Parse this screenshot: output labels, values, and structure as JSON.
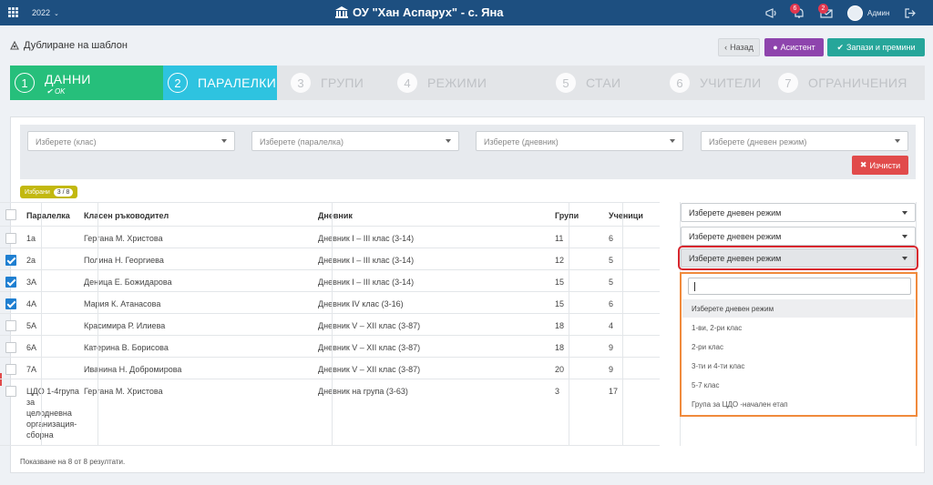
{
  "topbar": {
    "year": "2022",
    "school_name": "ОУ \"Хан Аспарух\" - с. Яна",
    "notifications_count": "6",
    "messages_count": "2",
    "user_name": "Админ",
    "icons": [
      "apps-grid-icon",
      "megaphone-icon",
      "bell-icon",
      "envelope-icon",
      "logout-icon"
    ]
  },
  "header": {
    "title": "Дублиране на шаблон",
    "back_label": "Назад",
    "assistant_label": "Асистент",
    "save_label": "Запази и премини"
  },
  "steps": [
    {
      "num": "1",
      "label": "ДАННИ",
      "status": "OK"
    },
    {
      "num": "2",
      "label": "ПАРАЛЕЛКИ"
    },
    {
      "num": "3",
      "label": "ГРУПИ"
    },
    {
      "num": "4",
      "label": "РЕЖИМИ"
    },
    {
      "num": "5",
      "label": "СТАИ"
    },
    {
      "num": "6",
      "label": "УЧИТЕЛИ"
    },
    {
      "num": "7",
      "label": "ОГРАНИЧЕНИЯ"
    }
  ],
  "filters": {
    "class_placeholder": "Изберете (клас)",
    "paralelka_placeholder": "Изберете (паралелка)",
    "dnevnik_placeholder": "Изберете (дневник)",
    "rezhim_placeholder": "Изберете (дневен режим)",
    "clear_label": "Изчисти"
  },
  "selected": {
    "label": "Избрани",
    "count": "3 / 8"
  },
  "table": {
    "headers": [
      "Паралелка",
      "Класен ръководител",
      "Дневник",
      "Групи",
      "Ученици"
    ],
    "header_regime": "Изберете дневен режим",
    "rows": [
      {
        "checked": false,
        "paralelka": "1а",
        "teacher": "Гергана М. Христова",
        "dnevnik": "Дневник I – III клас (3-14)",
        "grupi": "11",
        "uchenici": "6",
        "regime": "Изберете дневен режим"
      },
      {
        "checked": true,
        "paralelka": "2а",
        "teacher": "Полина Н. Георгиева",
        "dnevnik": "Дневник I – III клас (3-14)",
        "grupi": "12",
        "uchenici": "5",
        "regime": "Изберете дневен режим"
      },
      {
        "checked": true,
        "paralelka": "3А",
        "teacher": "Деница Е. Божидарова",
        "dnevnik": "Дневник I – III клас (3-14)",
        "grupi": "15",
        "uchenici": "5"
      },
      {
        "checked": true,
        "paralelka": "4А",
        "teacher": "Мария К. Атанасова",
        "dnevnik": "Дневник IV клас (3-16)",
        "grupi": "15",
        "uchenici": "6"
      },
      {
        "checked": false,
        "paralelka": "5А",
        "teacher": "Красимира Р. Илиева",
        "dnevnik": "Дневник V – XII клас (3-87)",
        "grupi": "18",
        "uchenici": "4"
      },
      {
        "checked": false,
        "paralelka": "6А",
        "teacher": "Катерина В. Борисова",
        "dnevnik": "Дневник V – XII клас (3-87)",
        "grupi": "18",
        "uchenici": "9"
      },
      {
        "checked": false,
        "paralelka": "7А",
        "teacher": "Иванина Н. Добромирова",
        "dnevnik": "Дневник V – XII клас (3-87)",
        "grupi": "20",
        "uchenici": "9"
      },
      {
        "checked": false,
        "paralelka": "ЦДО 1-4група за целодневна организация-сборна",
        "teacher": "Гергана М. Христова",
        "dnevnik": "Дневник на група (3-63)",
        "grupi": "3",
        "uchenici": "17"
      }
    ]
  },
  "dropdown": {
    "search_value": "",
    "options": [
      "Изберете дневен режим",
      "1-ви, 2-ри клас",
      "2-ри клас",
      "3-ти и 4-ти клас",
      "5-7 клас",
      "Група за ЦДО -начален етап"
    ]
  },
  "footer": {
    "results_text": "Показване на 8 от 8 резултати."
  }
}
